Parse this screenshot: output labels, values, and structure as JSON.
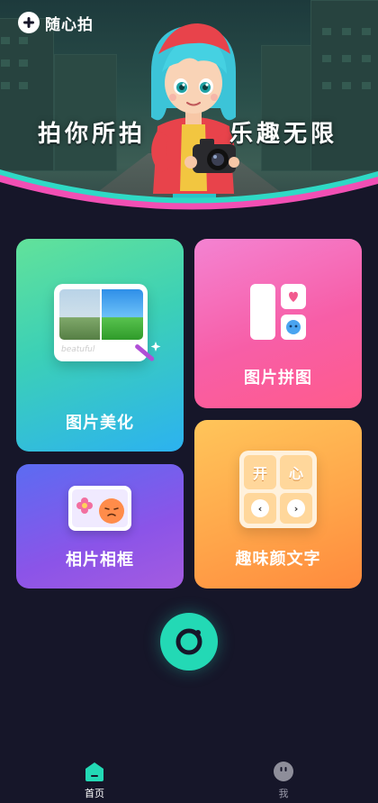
{
  "header": {
    "app_name": "随心拍",
    "logo_icon": "plus-icon"
  },
  "banner": {
    "slogan_left": "拍你所拍",
    "slogan_right": "乐趣无限"
  },
  "features": [
    {
      "label": "图片美化",
      "icon": "photo-beautify-illustration",
      "photo_caption": "beatuful"
    },
    {
      "label": "图片拼图",
      "icon": "collage-illustration"
    },
    {
      "label": "相片相框",
      "icon": "photo-frame-illustration"
    },
    {
      "label": "趣味颜文字",
      "icon": "emoji-text-illustration",
      "grid_chars": [
        "开",
        "心"
      ]
    }
  ],
  "fab": {
    "icon": "camera-icon"
  },
  "bottom_nav": {
    "items": [
      {
        "label": "首页",
        "icon": "home-icon",
        "active": true
      },
      {
        "label": "我",
        "icon": "profile-icon",
        "active": false
      }
    ]
  },
  "colors": {
    "background": "#161629",
    "accent": "#23d9b5",
    "beautify_card": "#3cd0b6",
    "collage_card": "#f75ea7",
    "frame_card": "#7a5cf0",
    "emoji_card": "#ffa64a"
  }
}
